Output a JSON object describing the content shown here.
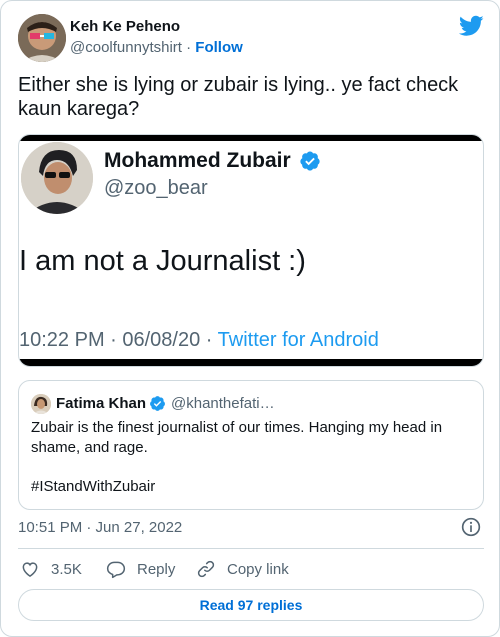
{
  "author": {
    "name": "Keh Ke Peheno",
    "handle": "@coolfunnytshirt",
    "separator": "·",
    "follow_label": "Follow"
  },
  "tweet": {
    "text": "Either she is lying or zubair is lying.. ye fact check kaun karega?"
  },
  "media": {
    "name": "Mohammed Zubair",
    "handle": "@zoo_bear",
    "text": "I am not a Journalist :)",
    "time_date": "10:22 PM · 06/08/20 · ",
    "source": "Twitter for Android"
  },
  "quoted": {
    "name": "Fatima Khan",
    "handle": "@khanthefati…",
    "text": "Zubair is the finest journalist of our times. Hanging my head in shame, and rage.",
    "hashtag": "#IStandWithZubair"
  },
  "timestamp": "10:51 PM · Jun 27, 2022",
  "actions": {
    "like_count": "3.5K",
    "reply_label": "Reply",
    "copy_label": "Copy link"
  },
  "replies_button": "Read 97 replies",
  "colors": {
    "link_blue": "#006fd6",
    "twitter_blue": "#1d9bf0",
    "muted": "#536471",
    "border": "#cfd9de"
  },
  "icons": [
    "twitter-bird-icon",
    "verified-badge-icon",
    "info-icon",
    "heart-icon",
    "reply-bubble-icon",
    "link-icon"
  ]
}
